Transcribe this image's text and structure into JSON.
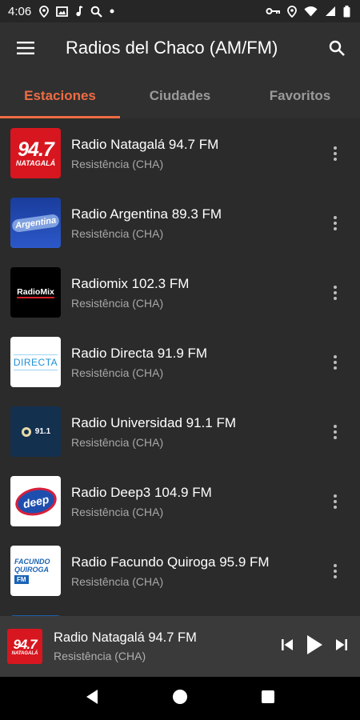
{
  "status": {
    "time": "4:06"
  },
  "app": {
    "title": "Radios del Chaco (AM/FM)"
  },
  "tabs": [
    {
      "label": "Estaciones",
      "active": true
    },
    {
      "label": "Ciudades",
      "active": false
    },
    {
      "label": "Favoritos",
      "active": false
    }
  ],
  "stations": [
    {
      "name": "Radio Natagalá 94.7 FM",
      "city": "Resistência (CHA)",
      "logo_text": "94.7",
      "logo_sub": "NATAGALÁ"
    },
    {
      "name": "Radio Argentina 89.3 FM",
      "city": "Resistência (CHA)",
      "logo_text": "Argentina"
    },
    {
      "name": "Radiomix 102.3 FM",
      "city": "Resistência (CHA)",
      "logo_text": "RadioMix"
    },
    {
      "name": "Radio Directa 91.9 FM",
      "city": "Resistência (CHA)",
      "logo_text": "DIRECTA"
    },
    {
      "name": "Radio Universidad 91.1 FM",
      "city": "Resistência (CHA)",
      "logo_text": "91.1"
    },
    {
      "name": "Radio Deep3 104.9 FM",
      "city": "Resistência (CHA)",
      "logo_text": "deep"
    },
    {
      "name": "Radio Facundo Quiroga 95.9 FM",
      "city": "Resistência (CHA)",
      "logo_text": "FACUNDO",
      "logo_sub": "QUIROGA",
      "logo_badge": "FM"
    }
  ],
  "player": {
    "name": "Radio Natagalá 94.7 FM",
    "city": "Resistência (CHA)",
    "logo_text": "94.7",
    "logo_sub": "NATAGALÁ"
  },
  "colors": {
    "accent": "#ef6c43",
    "background": "#2b2b2b",
    "appbar": "#303030",
    "player": "#3a3a3a"
  }
}
